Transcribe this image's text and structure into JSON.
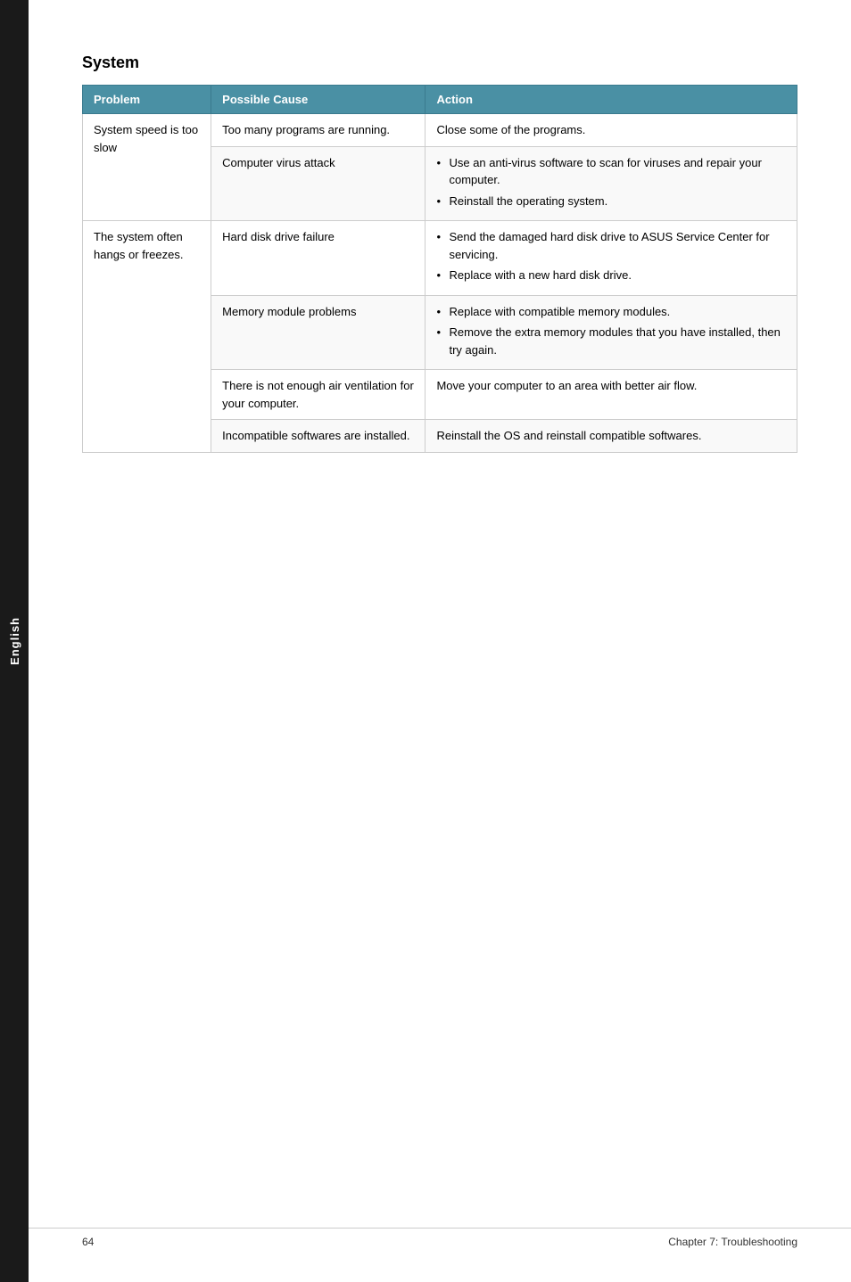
{
  "sidebar": {
    "label": "English"
  },
  "section": {
    "title": "System"
  },
  "table": {
    "headers": {
      "problem": "Problem",
      "cause": "Possible Cause",
      "action": "Action"
    },
    "rows": [
      {
        "problem": "System speed is too slow",
        "cause": "Too many programs are running.",
        "action_plain": "Close some of the programs.",
        "action_bullets": []
      },
      {
        "problem": "",
        "cause": "Computer virus attack",
        "action_plain": "",
        "action_bullets": [
          "Use an anti-virus software to scan for viruses and repair your computer.",
          "Reinstall the operating system."
        ]
      },
      {
        "problem": "The system often hangs or freezes.",
        "cause": "Hard disk drive failure",
        "action_plain": "",
        "action_bullets": [
          "Send the damaged hard disk drive to ASUS Service Center for servicing.",
          "Replace with a new hard disk drive."
        ]
      },
      {
        "problem": "",
        "cause": "Memory module problems",
        "action_plain": "",
        "action_bullets": [
          "Replace with compatible memory modules.",
          "Remove the extra memory modules that you have installed, then try again."
        ]
      },
      {
        "problem": "",
        "cause": "There is not enough air ventilation for your computer.",
        "action_plain": "Move your computer to an area with better air flow.",
        "action_bullets": []
      },
      {
        "problem": "",
        "cause": "Incompatible softwares are installed.",
        "action_plain": "Reinstall the OS and reinstall compatible softwares.",
        "action_bullets": []
      }
    ]
  },
  "footer": {
    "page_number": "64",
    "chapter": "Chapter 7: Troubleshooting"
  }
}
